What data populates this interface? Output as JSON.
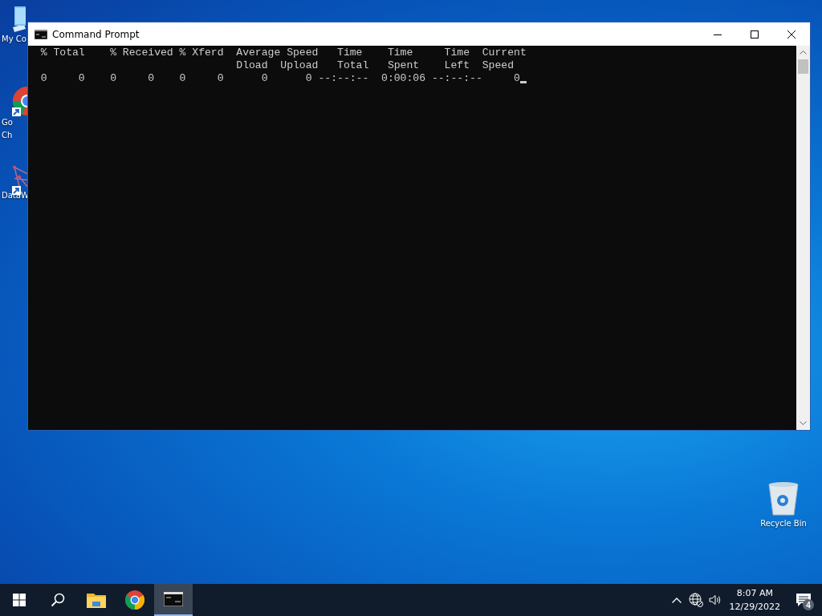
{
  "desktop_icons": [
    {
      "kind": "computer",
      "shortcut": false,
      "lines": [
        "My Co"
      ]
    },
    {
      "kind": "chrome",
      "shortcut": true,
      "lines": [
        "Go",
        "Ch"
      ]
    },
    {
      "kind": "app",
      "shortcut": true,
      "lines": [
        "DataW"
      ]
    },
    {
      "kind": "recycle",
      "shortcut": false,
      "lines": [
        "Recycle Bin"
      ]
    }
  ],
  "window": {
    "title": "Command Prompt",
    "console_lines": [
      "  % Total    % Received % Xferd  Average Speed   Time    Time     Time  Current",
      "                                 Dload  Upload   Total   Spent    Left  Speed",
      "  0     0    0     0    0     0      0      0 --:--:--  0:00:06 --:--:--     0"
    ]
  },
  "taskbar": {
    "apps": [
      {
        "kind": "start",
        "selected": false
      },
      {
        "kind": "search",
        "selected": false
      },
      {
        "kind": "explorer",
        "selected": false
      },
      {
        "kind": "chrome",
        "selected": false
      },
      {
        "kind": "cmd",
        "selected": true
      }
    ],
    "tray": {
      "time": "8:07 AM",
      "date": "12/29/2022",
      "notification_count": "4"
    }
  }
}
